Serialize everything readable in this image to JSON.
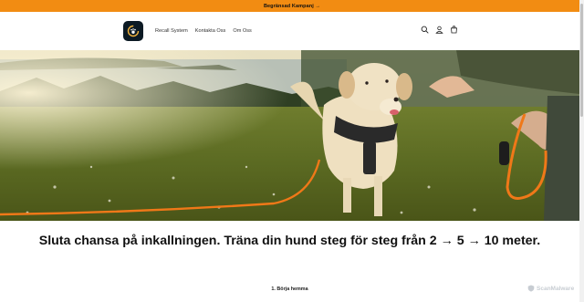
{
  "announcement": {
    "text": "Begränsad Kampanj →",
    "color": "#f28c12"
  },
  "header": {
    "logo_icon": "paw-logo-icon",
    "nav": [
      {
        "label": "Recall System"
      },
      {
        "label": "Kontakta Oss"
      },
      {
        "label": "Om Oss"
      }
    ],
    "icons": [
      "search-icon",
      "account-icon",
      "cart-icon"
    ]
  },
  "hero": {
    "image": "dog-with-orange-leash-photo"
  },
  "main": {
    "headline": "Sluta chansa på inkallningen. Träna din hund steg för steg från 2 → 5 → 10 meter.",
    "step_label": "1. Börja hemma"
  },
  "watermark": {
    "text": "ScanMalware"
  }
}
